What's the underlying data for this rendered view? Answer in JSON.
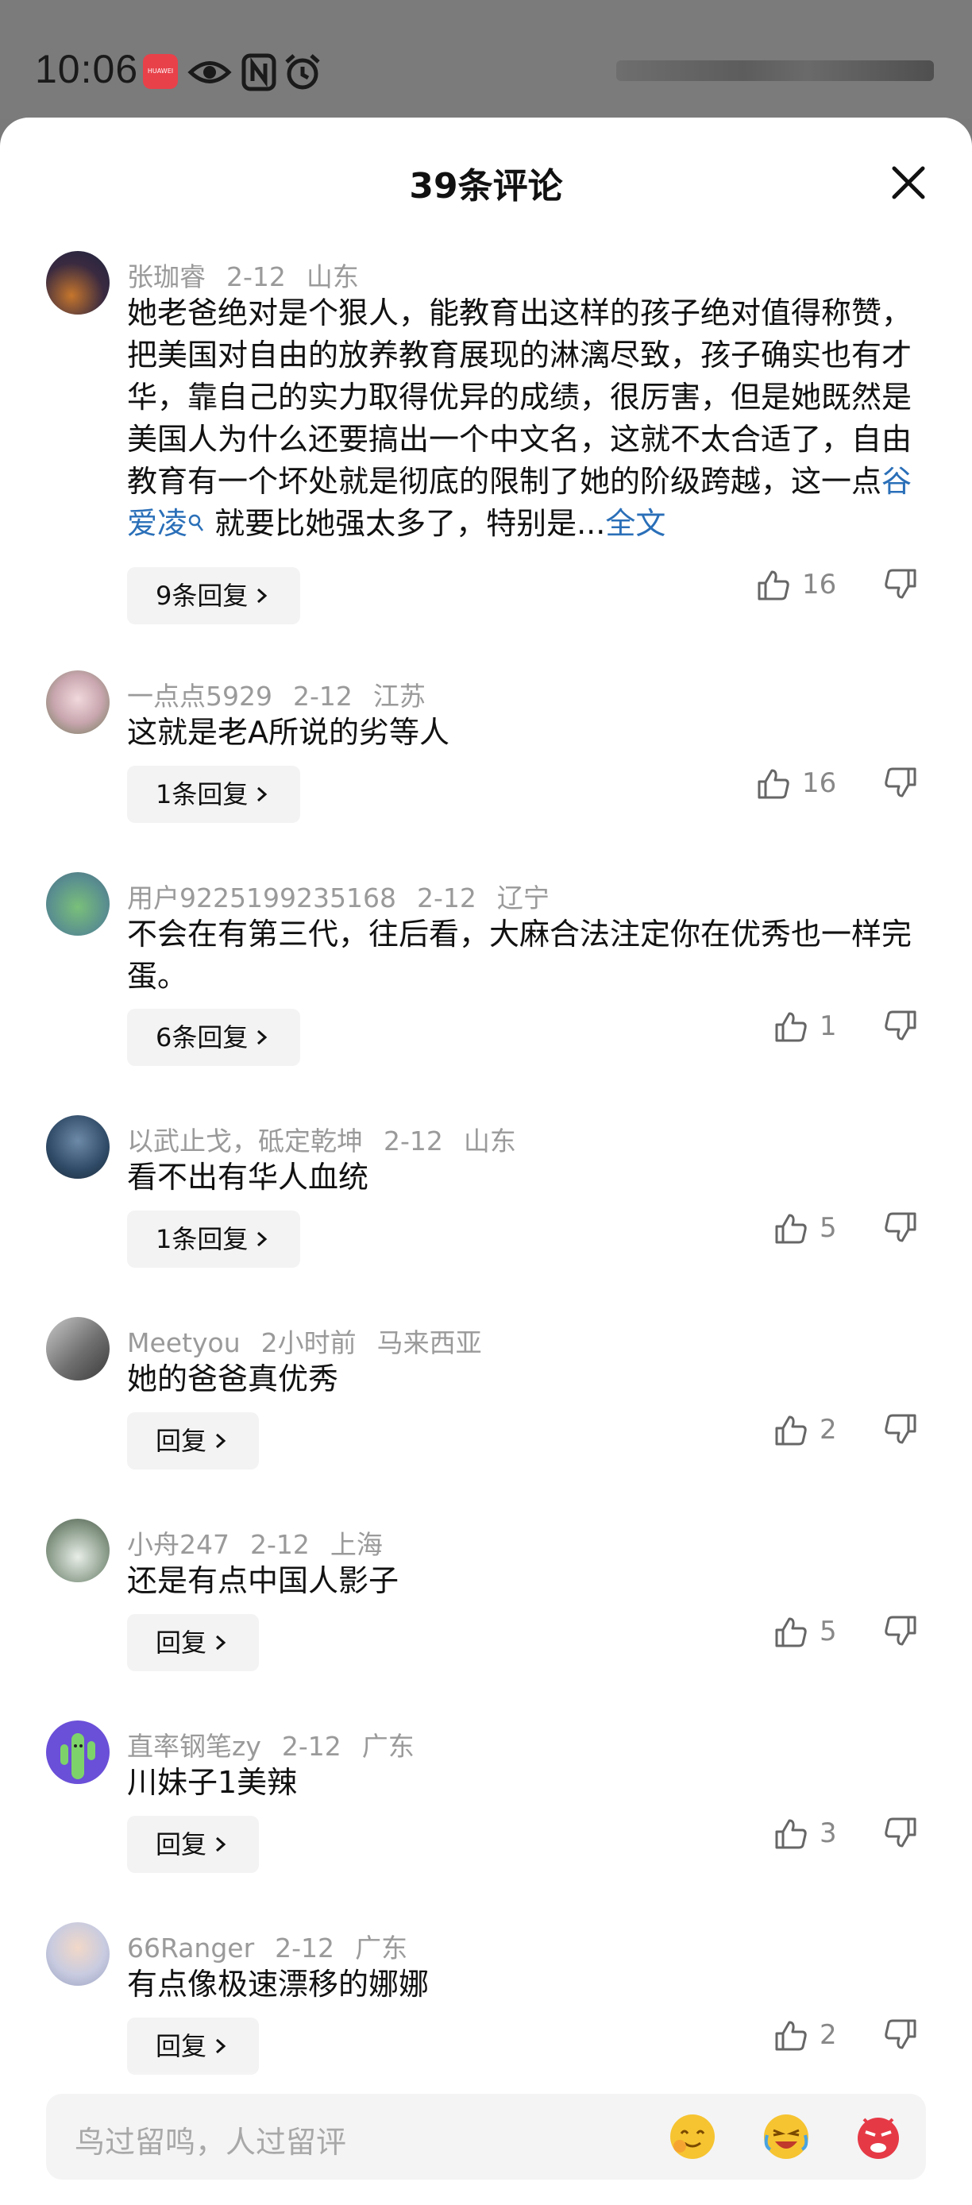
{
  "status_bar": {
    "time": "10:06",
    "app_badge": "HUAWEI"
  },
  "sheet": {
    "title": "39条评论"
  },
  "comments": [
    {
      "user": "张珈睿",
      "date": "2-12",
      "location": "山东",
      "text_before_link": "她老爸绝对是个狠人，能教育出这样的孩子绝对值得称赞，把美国对自由的放养教育展现的淋漓尽致，孩子确实也有才华，靠自己的实力取得优异的成绩，很厉害，但是她既然是美国人为什么还要搞出一个中文名，这就不太合适了，自由教育有一个坏处就是彻底的限制了她的阶级跨越，这一点",
      "link_text": "谷爱凌",
      "text_after_link": " 就要比她强太多了，特别是...",
      "full_text_label": "全文",
      "reply_label": "9条回复",
      "likes": "16"
    },
    {
      "user": "一点点5929",
      "date": "2-12",
      "location": "江苏",
      "text": "这就是老A所说的劣等人",
      "reply_label": "1条回复",
      "likes": "16"
    },
    {
      "user": "用户9225199235168",
      "date": "2-12",
      "location": "辽宁",
      "text": "不会在有第三代，往后看，大麻合法注定你在优秀也一样完蛋。",
      "reply_label": "6条回复",
      "likes": "1"
    },
    {
      "user": "以武止戈，砥定乾坤",
      "date": "2-12",
      "location": "山东",
      "text": "看不出有华人血统",
      "reply_label": "1条回复",
      "likes": "5"
    },
    {
      "user": "Meetyou",
      "date": "2小时前",
      "location": "马来西亚",
      "text": "她的爸爸真优秀",
      "reply_label": "回复",
      "likes": "2"
    },
    {
      "user": "小舟247",
      "date": "2-12",
      "location": "上海",
      "text": "还是有点中国人影子",
      "reply_label": "回复",
      "likes": "5"
    },
    {
      "user": "直率钢笔zy",
      "date": "2-12",
      "location": "广东",
      "text": "川妹子1美辣",
      "reply_label": "回复",
      "likes": "3"
    },
    {
      "user": "66Ranger",
      "date": "2-12",
      "location": "广东",
      "text": "有点像极速漂移的娜娜",
      "reply_label": "回复",
      "likes": "2"
    }
  ],
  "input": {
    "placeholder": "鸟过留鸣，人过留评"
  },
  "icons": [
    "eye-icon",
    "nfc-icon",
    "alarm-icon",
    "close-icon",
    "thumbs-up-icon",
    "thumbs-down-icon",
    "chevron-right-icon",
    "emoji-smile-icon",
    "emoji-laugh-icon",
    "emoji-angry-icon"
  ],
  "colors": {
    "link": "#2a6fb8",
    "meta": "#9a9a9a",
    "statusbar_bg": "#7b7b7b"
  }
}
